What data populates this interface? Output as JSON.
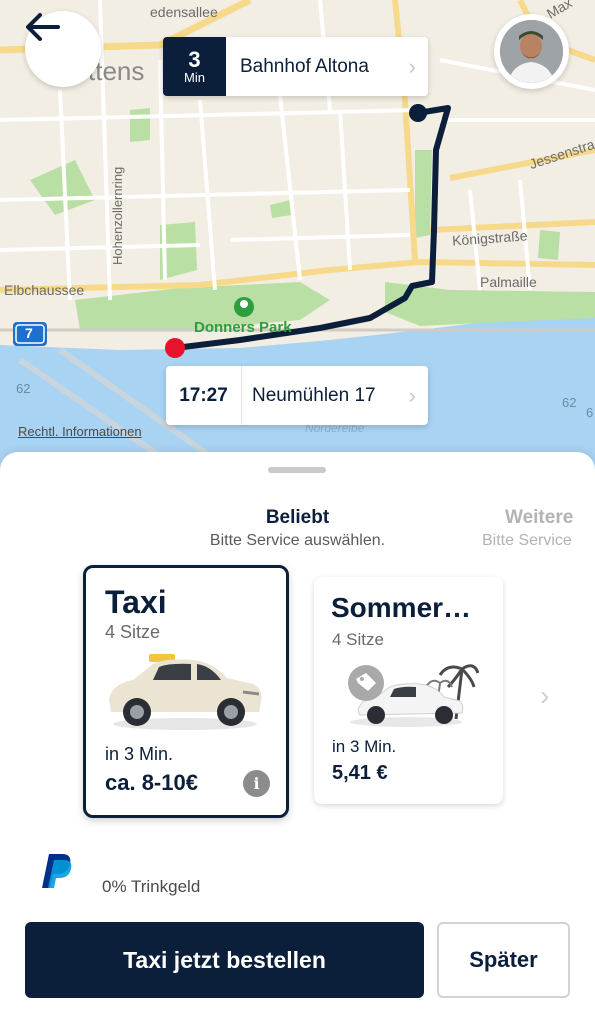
{
  "map": {
    "street_labels": [
      "edensallee",
      "ttens",
      "Hohenzollernring",
      "Jessenstra",
      "Königstraße",
      "Palmaille",
      "Elbchaussee",
      "62",
      "62",
      "6",
      "Norderelbe",
      "Max"
    ],
    "park_label": "Donners Park",
    "highway_badge": "7",
    "legal_link": "Rechtl. Informationen"
  },
  "pickup": {
    "eta_number": "3",
    "eta_unit": "Min",
    "location": "Bahnhof Altona"
  },
  "destination": {
    "time": "17:27",
    "location": "Neumühlen 17"
  },
  "categories": [
    {
      "title": "Beliebt",
      "subtitle": "Bitte Service auswählen."
    },
    {
      "title": "Weitere",
      "subtitle": "Bitte Service"
    }
  ],
  "services": [
    {
      "name": "Taxi",
      "seats": "4 Sitze",
      "eta": "in 3 Min.",
      "price": "ca. 8-10€",
      "selected": true
    },
    {
      "name": "Sommer…",
      "seats": "4 Sitze",
      "eta": "in 3 Min.",
      "price": "5,41 €",
      "selected": false
    }
  ],
  "payment": {
    "method_icon": "paypal-icon",
    "tip": "0% Trinkgeld"
  },
  "actions": {
    "order": "Taxi jetzt bestellen",
    "later": "Später"
  },
  "colors": {
    "navy": "#0b1f3a",
    "route": "#0b1f3a",
    "origin_dot": "#e8132b",
    "park_green": "#b9dfa4",
    "water": "#a9d3f2"
  }
}
